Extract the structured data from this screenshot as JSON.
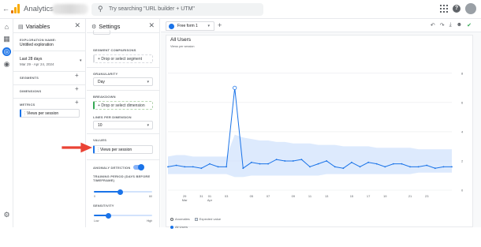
{
  "topbar": {
    "app_title": "Analytics",
    "search_placeholder": "Try searching \"URL builder + UTM\""
  },
  "variables_panel": {
    "title": "Variables",
    "exploration_name_label": "EXPLORATION NAME:",
    "exploration_name_value": "Untitled exploration",
    "date_range_label": "Last 28 days",
    "date_range_value": "Mar 29 - Apr 24, 2024",
    "segments_label": "SEGMENTS",
    "dimensions_label": "DIMENSIONS",
    "metrics_label": "METRICS",
    "metric_chip": "Views per session"
  },
  "settings_panel": {
    "title": "Settings",
    "segment_comparisons_label": "SEGMENT COMPARISONS",
    "segment_drop": "Drop or select segment",
    "granularity_label": "GRANULARITY",
    "granularity_value": "Day",
    "breakdown_label": "BREAKDOWN",
    "breakdown_drop": "Drop or select dimension",
    "lines_label": "LINES PER DIMENSION",
    "lines_value": "10",
    "values_label": "VALUES",
    "values_chip": "Views per session",
    "anomaly_label": "ANOMALY DETECTION",
    "anomaly_enabled": true,
    "training_label_1": "TRAINING PERIOD (DAYS BEFORE",
    "training_label_2": "TIMEFRAME)",
    "training_min": "0",
    "training_max": "60",
    "training_value": 0.45,
    "sensitivity_label": "SENSITIVITY",
    "sensitivity_low": "Low",
    "sensitivity_high": "High",
    "sensitivity_value": 0.25
  },
  "canvas": {
    "tab_label": "Free form 1",
    "card_title": "All Users",
    "card_subtitle": "Views per session",
    "legend_anomalies": "Anomalies",
    "legend_expected": "Expected value",
    "series_label": "All Users"
  },
  "colors": {
    "accent": "#1a73e8",
    "band": "#d2e3fc",
    "arrow": "#ea4335",
    "green": "#34a853"
  },
  "chart_data": {
    "type": "line",
    "title": "All Users",
    "subtitle": "Views per session",
    "x_tick_labels": [
      {
        "day": 2,
        "top": "29",
        "bottom": "Mar"
      },
      {
        "day": 4,
        "top": "31",
        "bottom": ""
      },
      {
        "day": 5,
        "top": "01",
        "bottom": "Apr"
      },
      {
        "day": 7,
        "top": "03",
        "bottom": ""
      },
      {
        "day": 10,
        "top": "05",
        "bottom": ""
      },
      {
        "day": 12,
        "top": "07",
        "bottom": ""
      },
      {
        "day": 15,
        "top": "09",
        "bottom": ""
      },
      {
        "day": 17,
        "top": "11",
        "bottom": ""
      },
      {
        "day": 19,
        "top": "13",
        "bottom": ""
      },
      {
        "day": 22,
        "top": "15",
        "bottom": ""
      },
      {
        "day": 24,
        "top": "17",
        "bottom": ""
      },
      {
        "day": 26,
        "top": "19",
        "bottom": ""
      },
      {
        "day": 29,
        "top": "21",
        "bottom": ""
      },
      {
        "day": 31,
        "top": "23",
        "bottom": ""
      }
    ],
    "y_ticks": [
      0,
      2,
      4,
      6,
      8
    ],
    "ylim": [
      0,
      9.5
    ],
    "xlim": [
      0,
      34
    ],
    "series": [
      {
        "name": "All Users",
        "values": [
          1.6,
          1.7,
          1.6,
          1.6,
          1.5,
          1.8,
          1.6,
          1.6,
          7.0,
          1.5,
          1.9,
          1.8,
          1.8,
          2.1,
          2.0,
          2.0,
          2.1,
          1.6,
          1.8,
          2.0,
          1.6,
          1.5,
          1.9,
          1.6,
          1.9,
          1.8,
          1.6,
          1.8,
          1.8,
          1.6,
          1.6,
          1.7,
          1.5,
          1.6,
          1.6
        ]
      }
    ],
    "anomalies": [
      8
    ],
    "expected_band": {
      "upper": [
        2.3,
        2.4,
        2.4,
        2.3,
        2.3,
        2.3,
        2.3,
        2.3,
        3.8,
        3.6,
        3.5,
        3.4,
        3.4,
        3.3,
        3.3,
        3.2,
        3.2,
        3.2,
        3.1,
        3.1,
        3.1,
        3.0,
        3.0,
        3.0,
        3.0,
        2.9,
        2.9,
        2.9,
        2.9,
        2.9,
        2.8,
        2.8,
        2.8,
        2.8,
        2.8
      ],
      "lower": [
        1.1,
        1.1,
        1.1,
        1.1,
        1.1,
        1.1,
        1.1,
        1.1,
        0.9,
        0.9,
        1.0,
        1.0,
        1.0,
        1.0,
        1.0,
        1.0,
        1.0,
        1.0,
        1.0,
        1.1,
        1.1,
        1.1,
        1.1,
        1.1,
        1.1,
        1.1,
        1.1,
        1.1,
        1.1,
        1.1,
        1.2,
        1.2,
        1.2,
        1.2,
        1.2
      ]
    }
  }
}
